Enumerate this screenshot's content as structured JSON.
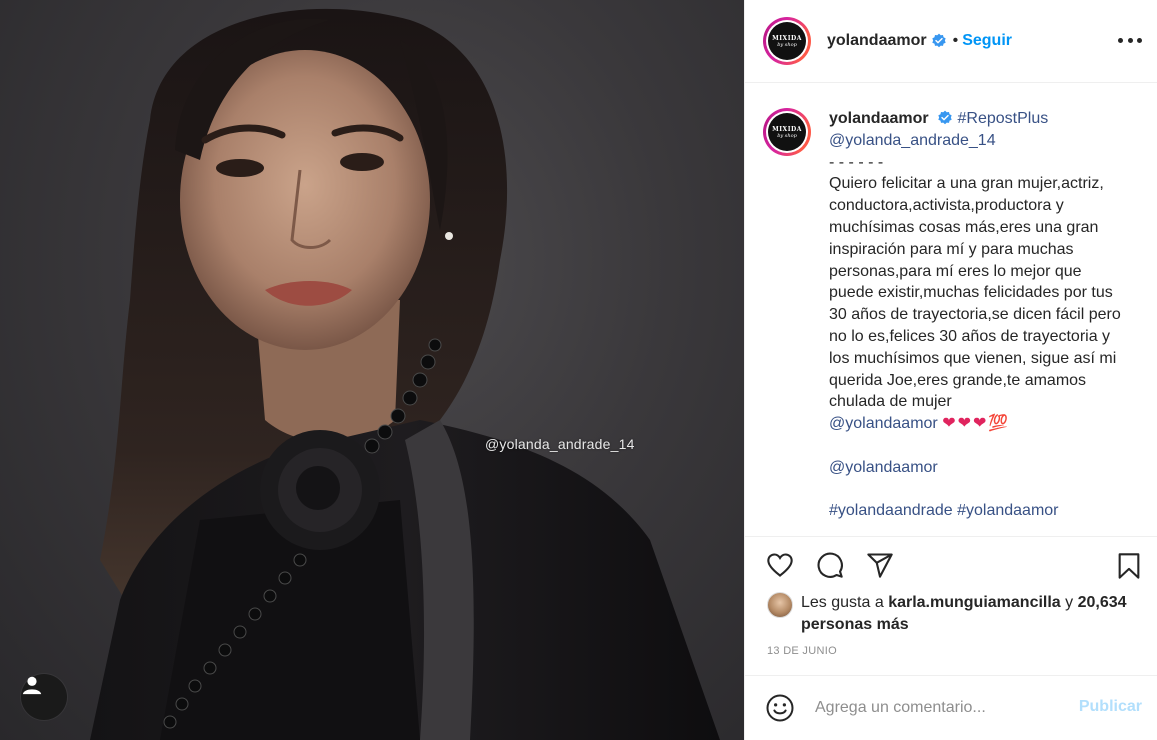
{
  "photo": {
    "watermark": "@yolanda_andrade_14",
    "profile_button_icon": "person-icon"
  },
  "header": {
    "username": "yolandaamor",
    "separator": "•",
    "follow_label": "Seguir",
    "avatar_logo_top": "MIXIDA",
    "avatar_logo_bottom": "by shop"
  },
  "caption": {
    "username": "yolandaamor",
    "hashtag_repost": "#RepostPlus",
    "mention_source": "@yolanda_andrade_14",
    "dashes": "- - - - - -",
    "body": "Quiero felicitar a una gran mujer,actriz, conductora,activista,productora y muchísimas cosas más,eres una gran inspiración para mí y para muchas personas,para mí eres lo mejor que puede existir,muchas felicidades por tus 30 años de trayectoria,se dicen fácil pero no lo es,felices 30 años de trayectoria y los muchísimos que vienen, sigue así mi querida Joe,eres grande,te amamos chulada de mujer",
    "mention_after_body": "@yolandaamor",
    "emojis": "❤❤❤💯",
    "mention_second": "@yolandaamor",
    "hashtags_final": "#yolandaandrade #yolandaamor"
  },
  "actions": {
    "icons": [
      "heart-icon",
      "comment-icon",
      "share-icon",
      "bookmark-icon"
    ]
  },
  "likes": {
    "prefix": "Les gusta a",
    "liker": "karla.munguiamancilla",
    "joiner": "y",
    "others": "20,634 personas más"
  },
  "date": "13 DE JUNIO",
  "comment": {
    "placeholder": "Agrega un comentario...",
    "publish_label": "Publicar",
    "emoji_icon": "smiley-icon"
  },
  "colors": {
    "accent": "#0095f6",
    "link": "#385185",
    "publish_disabled": "#b2dffc",
    "verified": "#3897f0"
  }
}
